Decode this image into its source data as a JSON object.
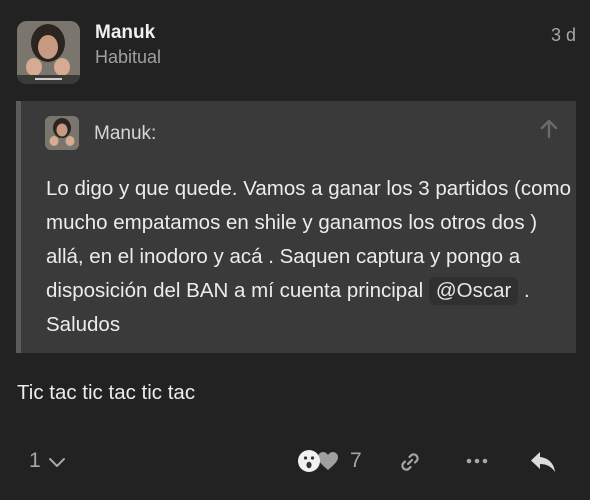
{
  "post": {
    "author": "Manuk",
    "user_title": "Habitual",
    "date": "3 d",
    "body": "Tic tac tic tac tic tac"
  },
  "quote": {
    "author": "Manuk:",
    "text_before_mention": "Lo digo y que quede. Vamos a ganar los 3 partidos (como mucho empatamos en shile y ganamos los otros dos ) allá, en el inodoro y acá . Saquen captura y pongo a disposición del BAN a mí cuenta principal ",
    "mention": "@Oscar",
    "text_after_mention": " . Saludos"
  },
  "footer": {
    "reply_count": "1",
    "reaction_count": "7",
    "icons": [
      "chevron-down-icon",
      "surprised-emoji-icon",
      "heart-icon",
      "link-icon",
      "more-icon",
      "reply-icon"
    ]
  },
  "colors": {
    "background": "#222222",
    "quote_background": "#3a3a3a",
    "quote_border": "#5b5b5b",
    "muted_text": "#a7a7a7"
  }
}
